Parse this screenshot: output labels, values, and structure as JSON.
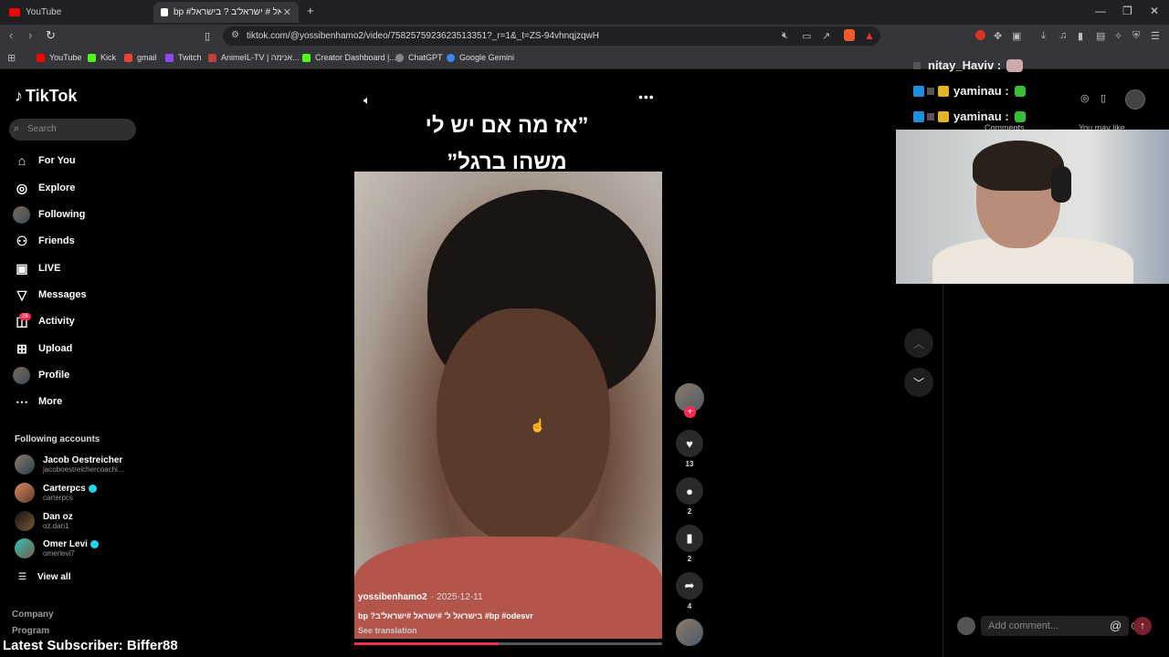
{
  "browser": {
    "tabs": [
      {
        "label": "YouTube",
        "color": "#ff0000"
      },
      {
        "label": "bp #ישראל # ישראל'ב ? בישראל",
        "color": "#ffffff"
      }
    ],
    "new_tab": "+",
    "url": "tiktok.com/@yossibenhamo2/video/7582575923623513351?_r=1&_t=ZS-94vhnqjzqwH",
    "bookmarks": [
      {
        "label": "YouTube",
        "color": "#ff0000"
      },
      {
        "label": "Kick",
        "color": "#53fc18"
      },
      {
        "label": "gmail",
        "color": "#ea4335"
      },
      {
        "label": "Twitch",
        "color": "#9146ff"
      },
      {
        "label": "AnimeIL-TV | אנימה...",
        "color": "#c04040"
      },
      {
        "label": "Creator Dashboard |...",
        "color": "#53fc18"
      },
      {
        "label": "ChatGPT",
        "color": "#888888"
      },
      {
        "label": "Google Gemini",
        "color": "#4285f4"
      }
    ]
  },
  "tiktok": {
    "brand": "TikTok",
    "search_placeholder": "Search",
    "nav": [
      {
        "label": "For You",
        "icon": "home-icon"
      },
      {
        "label": "Explore",
        "icon": "compass-icon"
      },
      {
        "label": "Following",
        "icon": "avatar"
      },
      {
        "label": "Friends",
        "icon": "friends-icon"
      },
      {
        "label": "LIVE",
        "icon": "live-icon"
      },
      {
        "label": "Messages",
        "icon": "messages-icon"
      },
      {
        "label": "Activity",
        "icon": "activity-icon"
      },
      {
        "label": "Upload",
        "icon": "upload-icon"
      },
      {
        "label": "Profile",
        "icon": "avatar"
      },
      {
        "label": "More",
        "icon": "more-icon"
      }
    ],
    "activity_badge": "26",
    "following_title": "Following accounts",
    "accounts": [
      {
        "name": "Jacob Oestreicher",
        "handle": "jacoboestreichercoachi...",
        "verified": false
      },
      {
        "name": "Carterpcs",
        "handle": "carterpcs",
        "verified": true
      },
      {
        "name": "Dan oz",
        "handle": "oz.dan1",
        "verified": false
      },
      {
        "name": "Omer Levi",
        "handle": "omerlevi7",
        "verified": true
      }
    ],
    "view_all": "View all",
    "footer": [
      "Company",
      "Program"
    ]
  },
  "video": {
    "overlay_line1": "”אז מה אם יש לי",
    "overlay_line2": "משהו ברגל”",
    "author": "yossibenhamo2",
    "date": "· 2025-12-11",
    "caption": "bp ?בישראל ל' #ישראל #ישראל'ב #bp #odesvr",
    "see_translation": "See translation",
    "progress_pct": 47,
    "likes": "13",
    "comments": "2",
    "saves": "2",
    "shares": "4"
  },
  "right_panel": {
    "tab_comments": "Comments",
    "tab_you_may_like": "You may like",
    "comment_placeholder": "Add comment..."
  },
  "overlay": {
    "chat": [
      {
        "user": "nitay_Haviv :"
      },
      {
        "user": "yaminau :"
      },
      {
        "user": "yaminau :"
      }
    ],
    "latest_subscriber": "Latest Subscriber: Biffer88"
  }
}
